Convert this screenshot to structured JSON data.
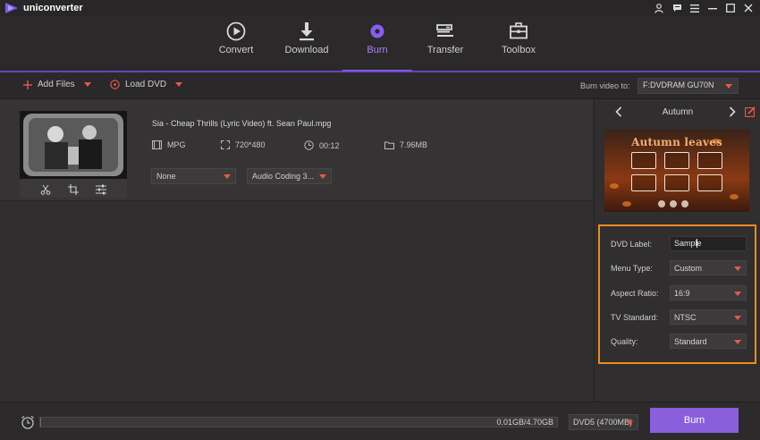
{
  "app": {
    "title": "uniconverter"
  },
  "nav": {
    "tabs": [
      {
        "label": "Convert",
        "icon": "convert-icon"
      },
      {
        "label": "Download",
        "icon": "download-icon"
      },
      {
        "label": "Burn",
        "icon": "burn-disc-icon",
        "active": true
      },
      {
        "label": "Transfer",
        "icon": "transfer-icon"
      },
      {
        "label": "Toolbox",
        "icon": "toolbox-icon"
      }
    ]
  },
  "toolbar": {
    "add_files": "Add Files",
    "load_dvd": "Load DVD",
    "burn_video_to_label": "Burn video to:",
    "burn_video_to_value": "F:DVDRAM GU70N"
  },
  "file": {
    "name": "Sia - Cheap Thrills (Lyric Video) ft. Sean Paul.mpg",
    "format": "MPG",
    "resolution": "720*480",
    "duration": "00:12",
    "size": "7.96MB",
    "subtitle_select": "None",
    "audio_select": "Audio Coding 3..."
  },
  "template": {
    "name": "Autumn",
    "preview_title": "Autumn leaves"
  },
  "settings": {
    "dvd_label": {
      "label": "DVD Label:",
      "value": "Sample"
    },
    "menu_type": {
      "label": "Menu Type:",
      "value": "Custom"
    },
    "aspect_ratio": {
      "label": "Aspect Ratio:",
      "value": "16:9"
    },
    "tv_standard": {
      "label": "TV Standard:",
      "value": "NTSC"
    },
    "quality": {
      "label": "Quality:",
      "value": "Standard"
    }
  },
  "footer": {
    "usage": "0.01GB/4.70GB",
    "usage_fraction": 0.002,
    "disc_type": "DVD5 (4700MB)",
    "burn_button": "Burn"
  },
  "colors": {
    "accent": "#8a5fdc",
    "highlight": "#f08a1c",
    "caret": "#e8594a"
  }
}
